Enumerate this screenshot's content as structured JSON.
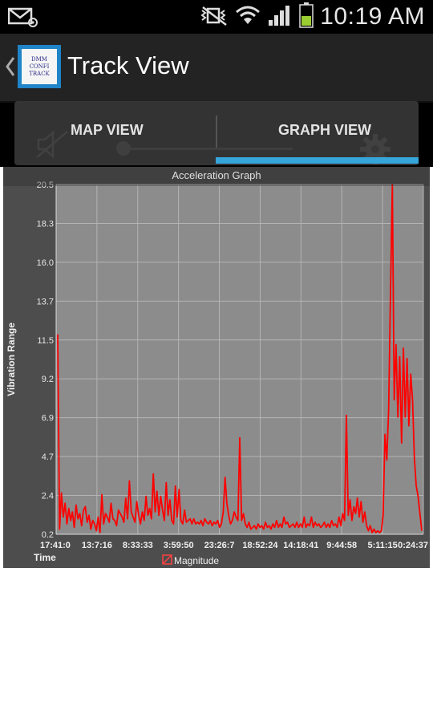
{
  "status_bar": {
    "time": "10:19 AM",
    "icons": [
      "email-notification-icon",
      "vibrate-mode-icon",
      "wifi-icon",
      "signal-icon",
      "battery-icon"
    ]
  },
  "action_bar": {
    "title": "Track View",
    "logo_lines": [
      "DMM",
      "CONFI",
      "TRACK"
    ]
  },
  "tabs": [
    {
      "label": "MAP VIEW",
      "selected": false
    },
    {
      "label": "GRAPH VIEW",
      "selected": true
    }
  ],
  "colors": {
    "accent": "#35a5da",
    "plot_bg": "#8c8c8c",
    "series": "#ff0000"
  },
  "chart_data": {
    "type": "line",
    "title": "Acceleration Graph",
    "ylabel": "Vibration Range",
    "xlabel": "Time",
    "ylim": [
      0.2,
      20.5
    ],
    "y_ticks": [
      "0.2",
      "2.4",
      "4.7",
      "6.9",
      "9.2",
      "11.5",
      "13.7",
      "16.0",
      "18.3",
      "20.5"
    ],
    "x_ticks": [
      "17:41:0",
      "13:7:16",
      "8:33:33",
      "3:59:50",
      "23:26:7",
      "18:52:24",
      "14:18:41",
      "9:44:58",
      "5:11:15",
      "0:24:37"
    ],
    "grid": true,
    "legend_position": "bottom",
    "series": [
      {
        "name": "Magnitude",
        "values": [
          11.8,
          0.5,
          2.6,
          1.2,
          2.0,
          0.8,
          1.7,
          1.0,
          1.5,
          0.6,
          1.9,
          1.1,
          1.4,
          0.7,
          1.6,
          1.8,
          0.9,
          1.3,
          0.5,
          1.0,
          0.8,
          0.4,
          1.2,
          0.3,
          2.5,
          0.8,
          1.4,
          1.2,
          0.9,
          2.0,
          1.1,
          1.0,
          0.7,
          1.6,
          1.4,
          1.2,
          0.9,
          2.3,
          1.1,
          3.3,
          1.5,
          1.2,
          0.9,
          2.1,
          1.3,
          0.8,
          1.5,
          1.0,
          2.4,
          1.3,
          1.7,
          1.1,
          3.7,
          1.5,
          2.7,
          1.3,
          2.4,
          1.6,
          1.0,
          3.2,
          1.3,
          2.2,
          1.0,
          0.8,
          3.0,
          1.2,
          2.8,
          1.0,
          0.8,
          1.6,
          0.9,
          1.0,
          1.1,
          0.8,
          1.1,
          0.8,
          0.9,
          0.8,
          1.0,
          0.7,
          1.1,
          0.9,
          0.8,
          1.0,
          0.7,
          0.9,
          0.8,
          1.0,
          0.6,
          0.8,
          1.5,
          3.5,
          2.0,
          1.3,
          0.8,
          1.0,
          1.5,
          1.2,
          1.0,
          5.8,
          1.0,
          1.4,
          0.8,
          0.6,
          0.9,
          0.5,
          0.6,
          0.7,
          0.5,
          0.8,
          0.6,
          0.7,
          0.5,
          0.9,
          0.6,
          0.7,
          0.5,
          0.8,
          0.6,
          1.0,
          0.6,
          0.8,
          0.6,
          1.2,
          0.8,
          0.9,
          0.6,
          0.7,
          0.8,
          0.6,
          0.9,
          0.6,
          0.8,
          0.6,
          1.2,
          0.6,
          0.8,
          0.7,
          1.2,
          0.6,
          0.9,
          0.7,
          0.8,
          0.6,
          0.7,
          0.9,
          0.6,
          0.8,
          0.6,
          1.0,
          0.7,
          0.8,
          0.6,
          1.2,
          0.7,
          1.4,
          1.0,
          7.1,
          1.3,
          2.2,
          1.0,
          1.8,
          1.4,
          2.3,
          1.2,
          2.1,
          0.9,
          1.5,
          0.7,
          0.4,
          0.7,
          0.3,
          0.5,
          0.3,
          0.4,
          0.3,
          0.4,
          1.3,
          6.0,
          4.5,
          7.5,
          14.2,
          20.5,
          8.0,
          11.2,
          7.0,
          10.5,
          5.5,
          11.0,
          7.0,
          10.4,
          6.5,
          9.5,
          8.0,
          4.6,
          3.0,
          2.4,
          1.4,
          0.4
        ]
      }
    ]
  }
}
